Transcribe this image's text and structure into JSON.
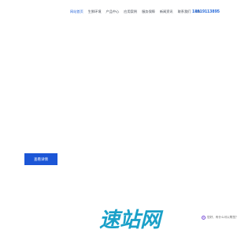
{
  "nav": {
    "items": [
      {
        "label": "网站首页",
        "active": true
      },
      {
        "label": "生鲜环境",
        "active": false
      },
      {
        "label": "产品中心",
        "active": false
      },
      {
        "label": "应用案例",
        "active": false
      },
      {
        "label": "服务保障",
        "active": false
      },
      {
        "label": "新闻资讯",
        "active": false
      },
      {
        "label": "联系我们",
        "active": false
      },
      {
        "label": "CN",
        "active": false
      }
    ]
  },
  "header": {
    "phone": "18819113895"
  },
  "hero": {
    "button_label": "查看详情"
  },
  "chat": {
    "text": "您好，有什么可以帮您？"
  },
  "watermark": {
    "text": "速站网"
  },
  "colors": {
    "accent": "#1c56d6",
    "watermark": "#1aa0c8"
  }
}
